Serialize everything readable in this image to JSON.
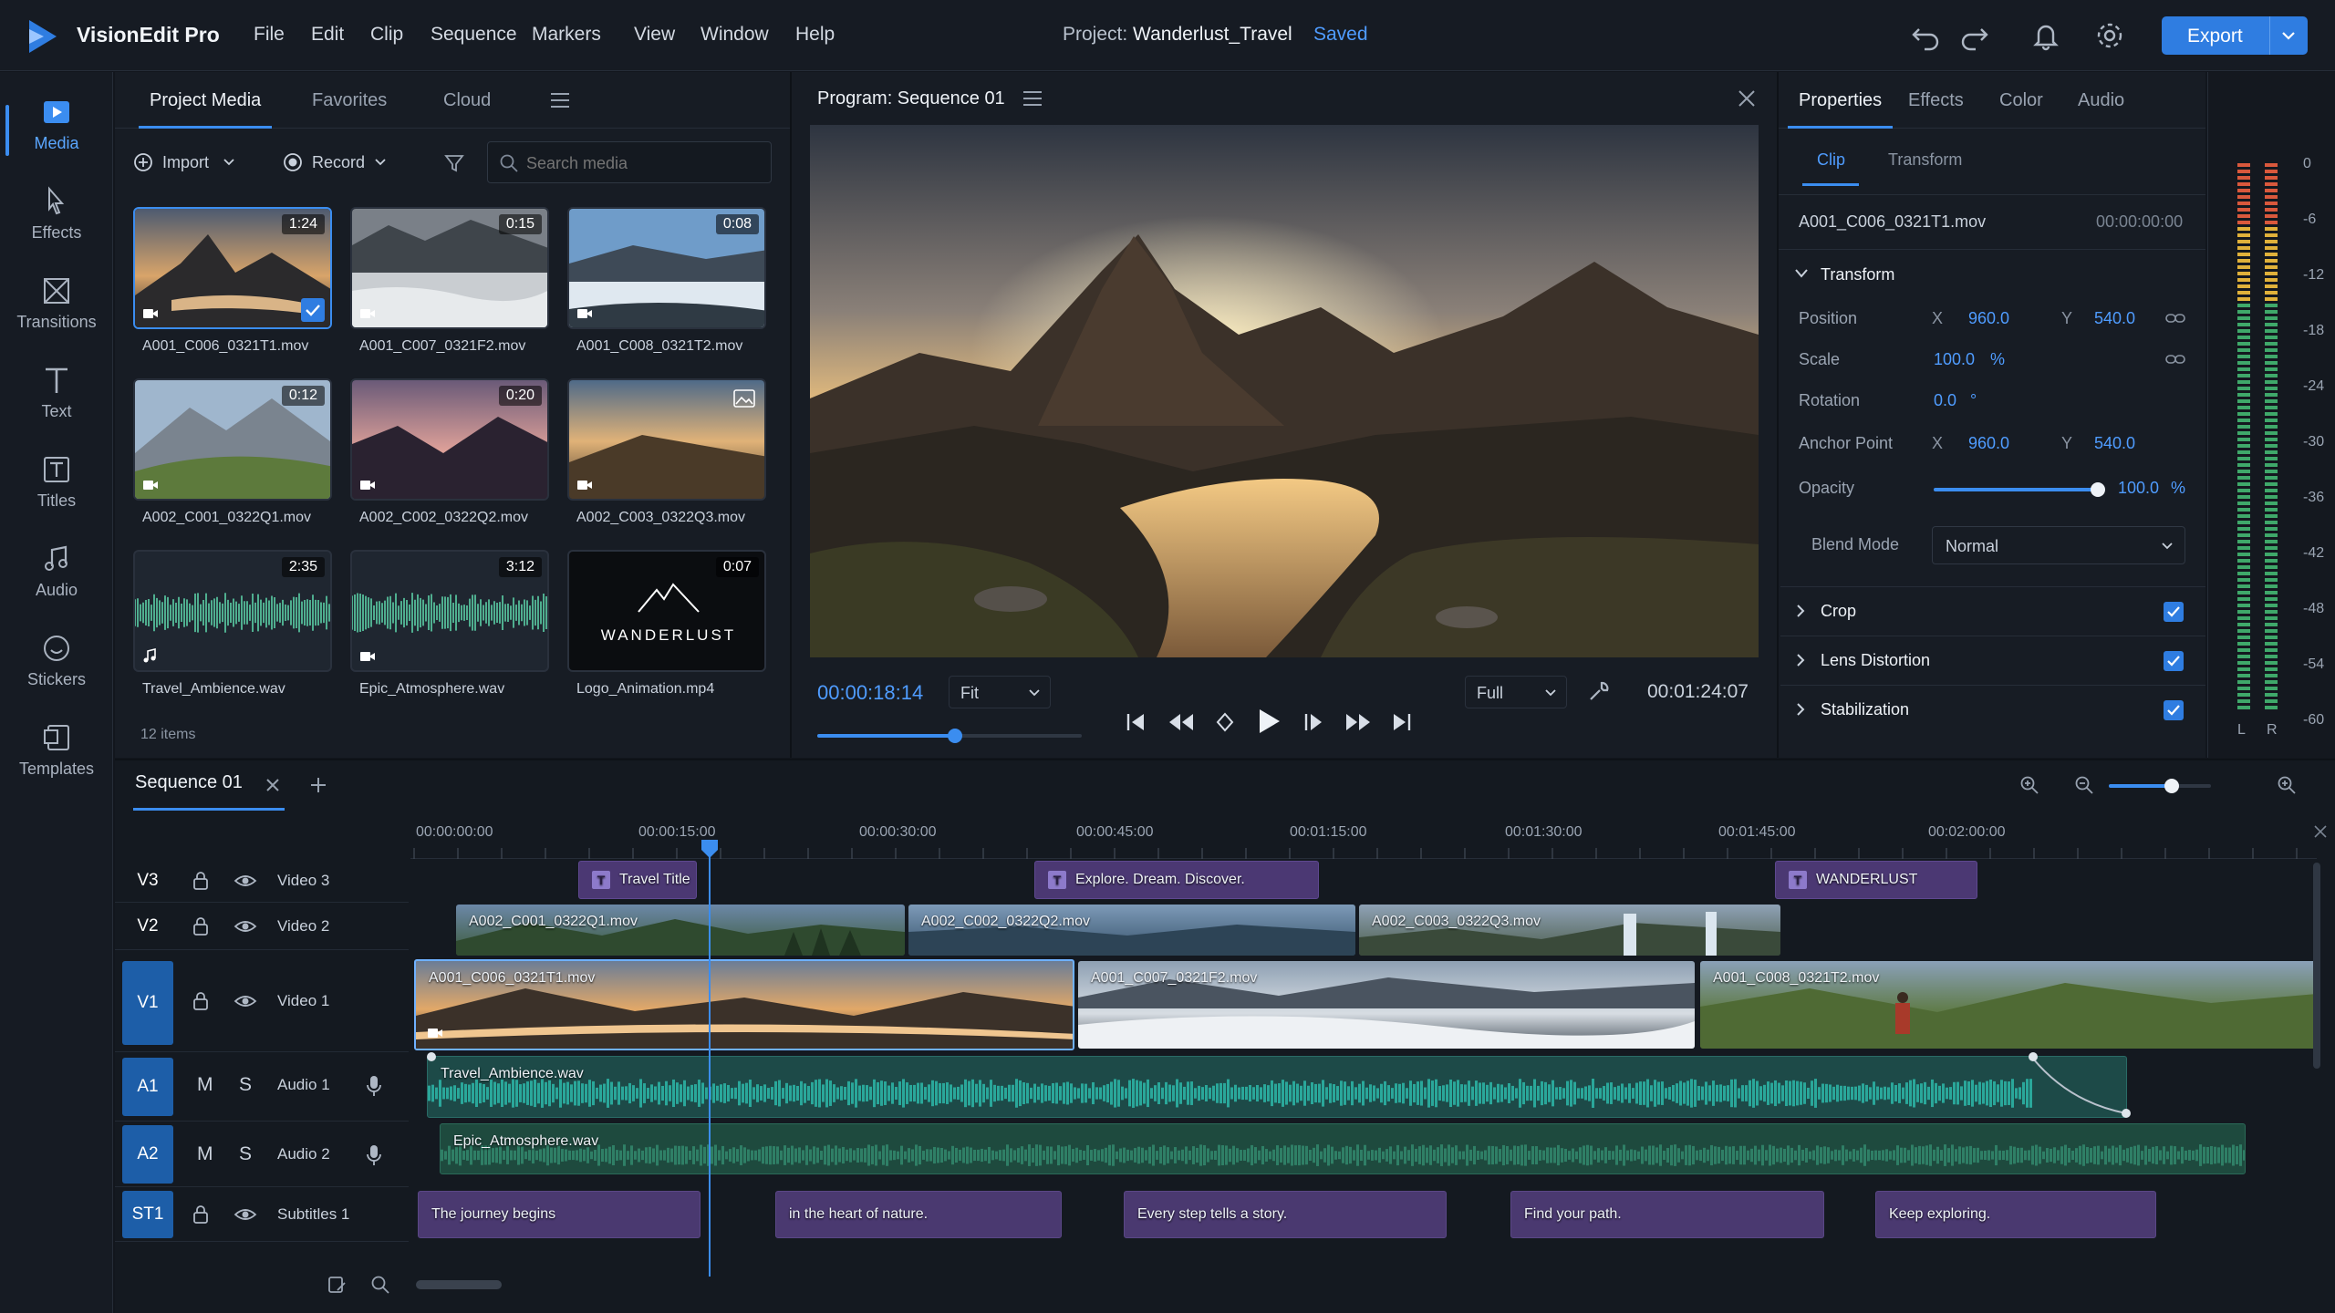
{
  "app": {
    "name": "VisionEdit Pro",
    "project_prefix": "Project:",
    "project_name": "Wanderlust_Travel",
    "save_status": "Saved",
    "export_label": "Export"
  },
  "menu": [
    "File",
    "Edit",
    "Clip",
    "Sequence",
    "Markers",
    "View",
    "Window",
    "Help"
  ],
  "sidebar": [
    {
      "label": "Media",
      "icon": "media-icon",
      "active": true
    },
    {
      "label": "Effects",
      "icon": "effects-icon"
    },
    {
      "label": "Transitions",
      "icon": "transitions-icon"
    },
    {
      "label": "Text",
      "icon": "text-icon"
    },
    {
      "label": "Titles",
      "icon": "titles-icon"
    },
    {
      "label": "Audio",
      "icon": "audio-icon"
    },
    {
      "label": "Stickers",
      "icon": "stickers-icon"
    },
    {
      "label": "Templates",
      "icon": "templates-icon"
    }
  ],
  "media_panel": {
    "tabs": [
      "Project Media",
      "Favorites",
      "Cloud"
    ],
    "import_label": "Import",
    "record_label": "Record",
    "search_placeholder": "Search media",
    "item_count": "12 items",
    "items": [
      {
        "name": "A001_C006_0321T1.mov",
        "duration": "1:24",
        "kind": "video",
        "selected": true
      },
      {
        "name": "A001_C007_0321F2.mov",
        "duration": "0:15",
        "kind": "video"
      },
      {
        "name": "A001_C008_0321T2.mov",
        "duration": "0:08",
        "kind": "video"
      },
      {
        "name": "A002_C001_0322Q1.mov",
        "duration": "0:12",
        "kind": "video"
      },
      {
        "name": "A002_C002_0322Q2.mov",
        "duration": "0:20",
        "kind": "video"
      },
      {
        "name": "A002_C003_0322Q3.mov",
        "duration": "",
        "kind": "image"
      },
      {
        "name": "Travel_Ambience.wav",
        "duration": "2:35",
        "kind": "audio"
      },
      {
        "name": "Epic_Atmosphere.wav",
        "duration": "3:12",
        "kind": "audio"
      },
      {
        "name": "Logo_Animation.mp4",
        "duration": "0:07",
        "kind": "logo",
        "logo_text": "WANDERLUST"
      }
    ]
  },
  "program": {
    "title": "Program: Sequence 01",
    "current_time": "00:00:18:14",
    "fit_label": "Fit",
    "quality_label": "Full",
    "total_time": "00:01:24:07",
    "scrub_position": 0.52
  },
  "properties": {
    "tabs": [
      "Properties",
      "Effects",
      "Color",
      "Audio"
    ],
    "subtabs": [
      "Clip",
      "Transform"
    ],
    "clip_name": "A001_C006_0321T1.mov",
    "clip_time": "00:00:00:00",
    "transform_label": "Transform",
    "position": {
      "label": "Position",
      "x": "960.0",
      "y": "540.0"
    },
    "scale": {
      "label": "Scale",
      "value": "100.0",
      "unit": "%"
    },
    "rotation": {
      "label": "Rotation",
      "value": "0.0",
      "unit": "°"
    },
    "anchor": {
      "label": "Anchor Point",
      "x": "960.0",
      "y": "540.0"
    },
    "opacity": {
      "label": "Opacity",
      "value": "100.0",
      "unit": "%",
      "level": 1.0
    },
    "blend": {
      "label": "Blend Mode",
      "value": "Normal"
    },
    "sections": [
      "Crop",
      "Lens Distortion",
      "Stabilization"
    ],
    "axis_x": "X",
    "axis_y": "Y"
  },
  "meter": {
    "scale": [
      "0",
      "-6",
      "-12",
      "-18",
      "-24",
      "-30",
      "-36",
      "-42",
      "-48",
      "-54",
      "-60"
    ],
    "left": "L",
    "right": "R"
  },
  "timeline": {
    "sequence_tab": "Sequence 01",
    "ruler": [
      "00:00:00:00",
      "00:00:15:00",
      "00:00:30:00",
      "00:00:45:00",
      "00:01:15:00",
      "00:01:30:00",
      "00:01:45:00",
      "00:02:00:00"
    ],
    "zoom_level": 0.62,
    "tracks": [
      {
        "tag": "V3",
        "name": "Video 3"
      },
      {
        "tag": "V2",
        "name": "Video 2"
      },
      {
        "tag": "V1",
        "name": "Video 1"
      },
      {
        "tag": "A1",
        "name": "Audio 1",
        "m": "M",
        "s": "S"
      },
      {
        "tag": "A2",
        "name": "Audio 2",
        "m": "M",
        "s": "S"
      },
      {
        "tag": "ST1",
        "name": "Subtitles 1"
      }
    ],
    "titles": [
      "Travel Title",
      "Explore. Dream. Discover.",
      "WANDERLUST"
    ],
    "v2_clips": [
      "A002_C001_0322Q1.mov",
      "A002_C002_0322Q2.mov",
      "A002_C003_0322Q3.mov"
    ],
    "v1_clips": [
      "A001_C006_0321T1.mov",
      "A001_C007_0321F2.mov",
      "A001_C008_0321T2.mov"
    ],
    "a1_clip": "Travel_Ambience.wav",
    "a2_clip": "Epic_Atmosphere.wav",
    "subtitles": [
      "The journey begins",
      "in the heart of nature.",
      "Every step tells a story.",
      "Find your path.",
      "Keep exploring."
    ]
  },
  "colors": {
    "accent": "#3b8df0",
    "title_clip": "#4b3873",
    "audio_clip": "#1e6f6a",
    "track_tag": "#1d5ea8"
  }
}
